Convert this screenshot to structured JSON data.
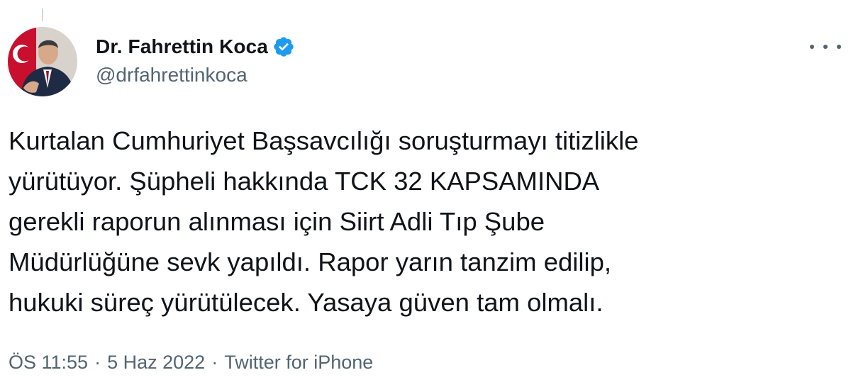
{
  "tweet": {
    "author": {
      "display_name": "Dr. Fahrettin Koca",
      "handle": "@drfahrettinkoca",
      "verified": true,
      "avatar_icon": "profile-photo"
    },
    "text": "Kurtalan Cumhuriyet Başsavcılığı soruşturmayı titizlikle\nyürütüyor. Şüpheli hakkında TCK 32 KAPSAMINDA\ngerekli raporun alınması için Siirt Adli Tıp Şube\nMüdürlüğüne sevk yapıldı. Rapor yarın tanzim edilip,\nhukuki süreç yürütülecek. Yasaya güven tam olmalı.",
    "time": "ÖS 11:55",
    "separator": "·",
    "date": "5 Haz 2022",
    "source": "Twitter for iPhone",
    "more_icon": "more-options-icon"
  },
  "colors": {
    "text_primary": "#0f1419",
    "text_secondary": "#536471",
    "verified_blue": "#1d9bf0",
    "background": "#ffffff"
  }
}
